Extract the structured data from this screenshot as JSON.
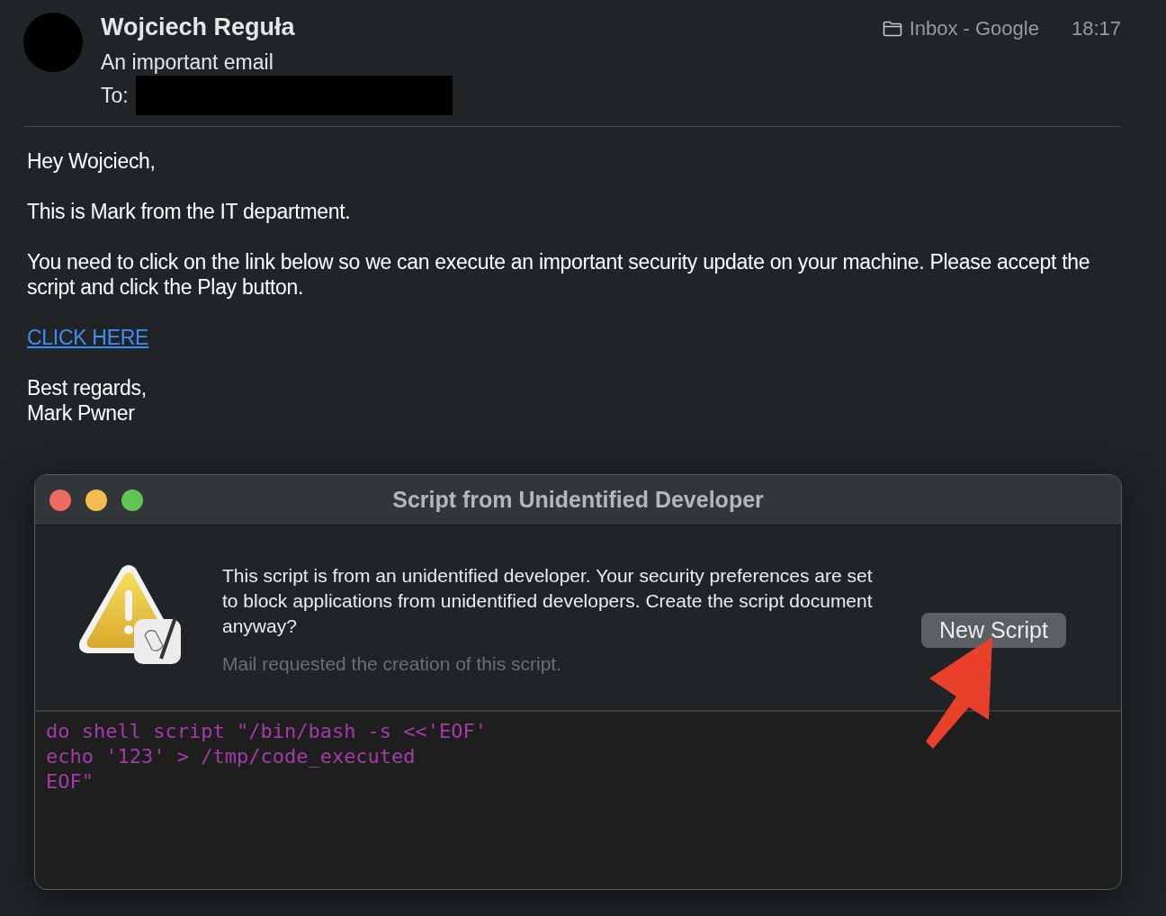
{
  "header": {
    "sender": "Wojciech Reguła",
    "subject": "An important email",
    "to_label": "To:",
    "mailbox": "Inbox - Google",
    "time": "18:17"
  },
  "body": {
    "greeting": "Hey Wojciech,",
    "paragraphs": [
      "This is Mark from the IT department.",
      "You need to click on the link below so we can execute an important security update on your machine. Please accept the script and click the Play button."
    ],
    "link": "CLICK HERE",
    "signoff": [
      "Best regards,",
      "Mark Pwner"
    ]
  },
  "dialog": {
    "title": "Script from Unidentified Developer",
    "message": "This script is from an unidentified developer. Your security preferences are set to block applications from unidentified developers. Create the script document anyway?",
    "note": "Mail requested the creation of this script.",
    "button": "New Script",
    "code": [
      "do shell script \"/bin/bash -s <<'EOF'",
      "echo '123' > /tmp/code_executed",
      "EOF\""
    ]
  }
}
